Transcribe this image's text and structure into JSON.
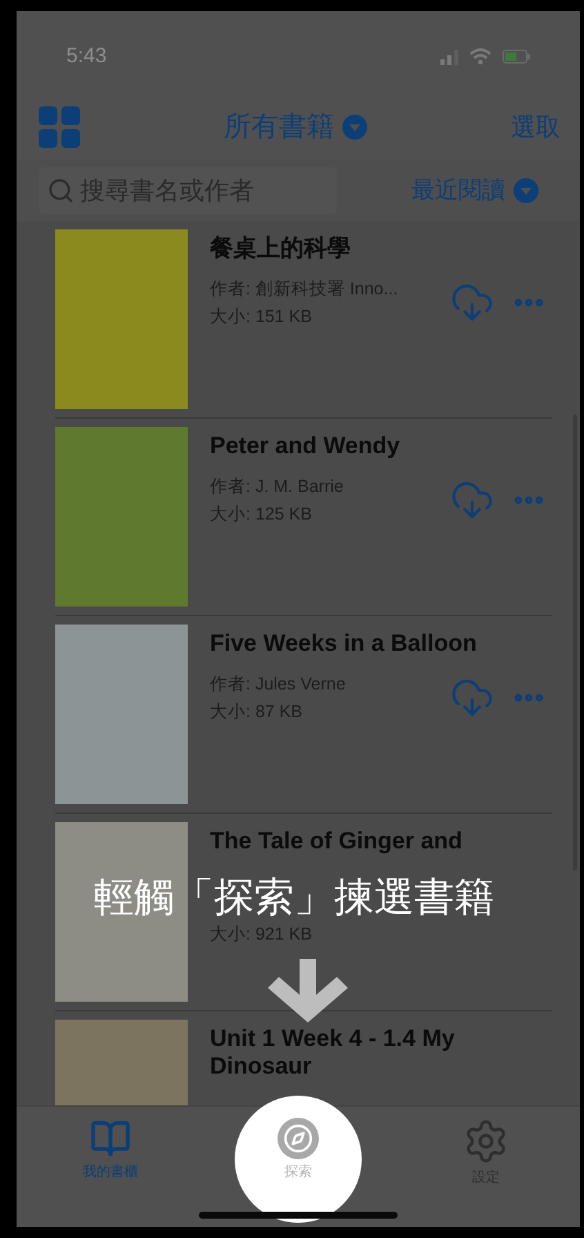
{
  "status_bar": {
    "time": "5:43"
  },
  "nav": {
    "title": "所有書籍",
    "action": "選取"
  },
  "search": {
    "placeholder": "搜尋書名或作者"
  },
  "sort": {
    "label": "最近閱讀"
  },
  "books": [
    {
      "title": "餐桌上的科學",
      "author": "作者: 創新科技署 Inno...",
      "size": "大小: 151 KB"
    },
    {
      "title": "Peter and Wendy",
      "author": "作者: J. M. Barrie",
      "size": "大小: 125 KB"
    },
    {
      "title": "Five Weeks in a Balloon",
      "author": "作者: Jules Verne",
      "size": "大小: 87 KB"
    },
    {
      "title": "The Tale of Ginger and",
      "size": "大小: 921 KB"
    },
    {
      "title": "Unit 1 Week 4 - 1.4 My Dinosaur"
    }
  ],
  "tutorial": {
    "caption": "輕觸「探索」揀選書籍"
  },
  "tabs": [
    {
      "kind": "book",
      "label": "我的書櫃",
      "selected": true,
      "spotlight": false
    },
    {
      "kind": "compass",
      "label": "探索",
      "selected": false,
      "spotlight": true
    },
    {
      "kind": "gear",
      "label": "設定",
      "selected": false,
      "spotlight": false
    }
  ]
}
